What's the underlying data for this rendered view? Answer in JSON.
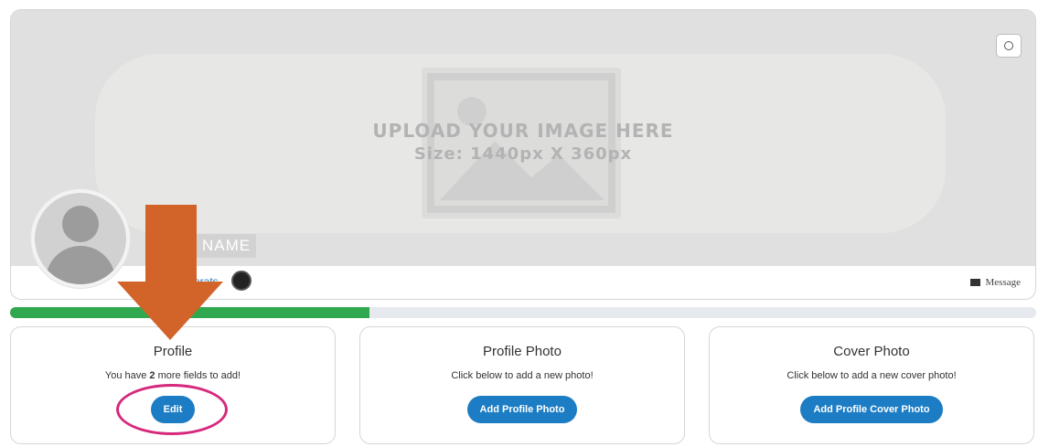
{
  "cover": {
    "upload_line1": "UPLOAD YOUR IMAGE HERE",
    "upload_line2": "Size: 1440px X 360px",
    "camera_icon": "camera-icon"
  },
  "profile_header": {
    "name": "R NAME",
    "carats_link": "arats",
    "message_label": "Message",
    "message_icon": "envelope-icon"
  },
  "progress": {
    "fraction": 0.35,
    "color": "#2fa84f"
  },
  "cards": [
    {
      "title": "Profile",
      "desc_prefix": "You have ",
      "desc_count": "2",
      "desc_suffix": " more fields to add!",
      "button": "Edit"
    },
    {
      "title": "Profile Photo",
      "desc": "Click below to add a new photo!",
      "button": "Add Profile Photo"
    },
    {
      "title": "Cover Photo",
      "desc": "Click below to add a new cover photo!",
      "button": "Add Profile Cover Photo"
    }
  ],
  "colors": {
    "accent": "#1c7dc4",
    "arrow": "#d2642a",
    "highlight": "#d6287d"
  }
}
